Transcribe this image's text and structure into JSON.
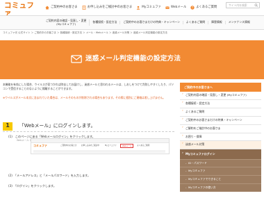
{
  "header": {
    "logo": "コミュファ",
    "logo_sub": "Powered by ctc",
    "nav": [
      {
        "label": "ご契約中のお客さま",
        "icon": "house-icon",
        "color": "#f28a33"
      },
      {
        "label": "お申し込みをご検討中のお客さま",
        "icon": "document-icon",
        "color": "#f28a33"
      },
      {
        "label": "Myコミュファ",
        "icon": "person-icon",
        "color": "#f28a33"
      },
      {
        "label": "Webメール",
        "icon": "mail-icon",
        "color": "#f28a33"
      },
      {
        "label": "よくあるご質問",
        "icon": "question-icon",
        "color": "#f28a33"
      }
    ],
    "search_placeholder": "サイト内を検索"
  },
  "subnav": [
    "ご契約内容の確認・見直し・変更\n(Myコミュファ)",
    "各種接続・設定方法",
    "ご契約中のお客さまだけの特典・キャンペーン",
    "よくあるご質問",
    "障害情報",
    "メンテナンス情報"
  ],
  "breadcrumb": "コミュファ光 公式サイト ＞ ご契約中のお客さま ＞ 各種接続・設定方法 ＞ メール・Webメール ＞ 迷惑メール対策 ＞ 迷惑メール判定機能の設定方法",
  "hero": {
    "title": "迷惑メール判定機能の設定方法",
    "icon": "mail-envelope-icon"
  },
  "main": {
    "intro": "本機能を有効にした場合、ウイルスが見つかれば除去してお届けし、迷惑メールと思われるメールは、しおしをつけて判別しやすくしたり、パソコンで受信することのないように隔離することができます。",
    "warning": "※ウイルスがメール本文に含まれていた場合は、メールそのものが削除される場合もあります。その際に個別にご連絡は差し上げません。",
    "step_number": "1",
    "step_title": "「Webメール」にログインします。",
    "instructions": [
      "(1)　このページにある「Webメールログイン」をクリックします。",
      "(2)　「メールアドレス」と「メールパスワード」を入力します。",
      "(3)　「ログイン」をクリックします。"
    ],
    "instruction_sub": "Webメール ログイン",
    "shot": {
      "logo": "コミュファ",
      "tabs": [
        "ご契約中のお客さま",
        "お申し込みをご検討中",
        "Myコミュファ",
        "Webメール",
        "よくあるご質問"
      ],
      "highlight_index": 3
    }
  },
  "sidebar": {
    "heading": "ご契約中のお客さまへ",
    "items": [
      "ご契約内容の確認・見直し・変更 (Myコミュファ)",
      "各種接続・設定方法",
      "よくあるご質問",
      "ご契約中のお客さまだけの特典・キャンペーン",
      "ご解約をご検討中のお客さま",
      "お困り・保障"
    ],
    "active_label": "迷惑メール対策",
    "dark_heading": "Myコミュファログイン",
    "sub_items": [
      "ID・パスワード",
      "Myコミュファ",
      "Myコミュファでできること",
      "Myコミュファの使い方"
    ]
  }
}
